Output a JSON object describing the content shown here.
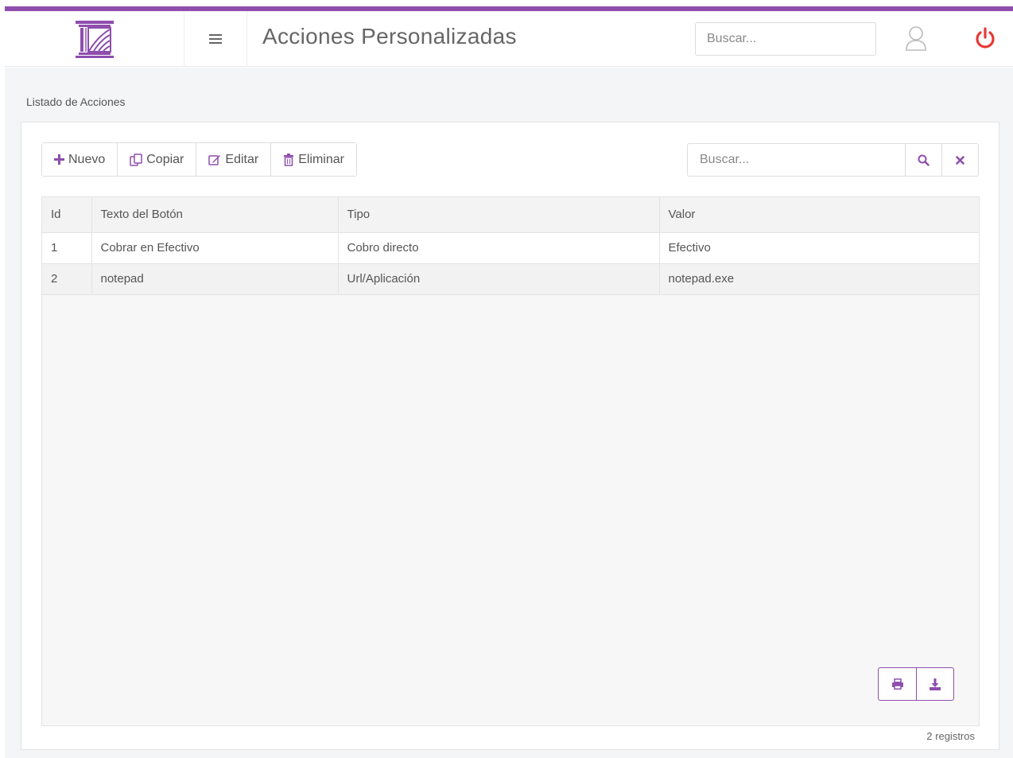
{
  "header": {
    "title": "Acciones Personalizadas",
    "search_placeholder": "Buscar...",
    "accent_color": "#8e4ead",
    "power_color": "#e53935",
    "logo_icon": "columns-logo-icon",
    "menu_icon": "hamburger-icon",
    "user_icon": "user-icon",
    "power_icon": "power-icon"
  },
  "main": {
    "section_label": "Listado de Acciones",
    "toolbar": {
      "new_label": "Nuevo",
      "copy_label": "Copiar",
      "edit_label": "Editar",
      "delete_label": "Eliminar"
    },
    "grid_search_placeholder": "Buscar...",
    "table": {
      "columns": [
        "Id",
        "Texto del Botón",
        "Tipo",
        "Valor"
      ],
      "rows": [
        [
          "1",
          "Cobrar en Efectivo",
          "Cobro directo",
          "Efectivo"
        ],
        [
          "2",
          "notepad",
          "Url/Aplicación",
          "notepad.exe"
        ]
      ]
    },
    "records_text": "2 registros"
  }
}
